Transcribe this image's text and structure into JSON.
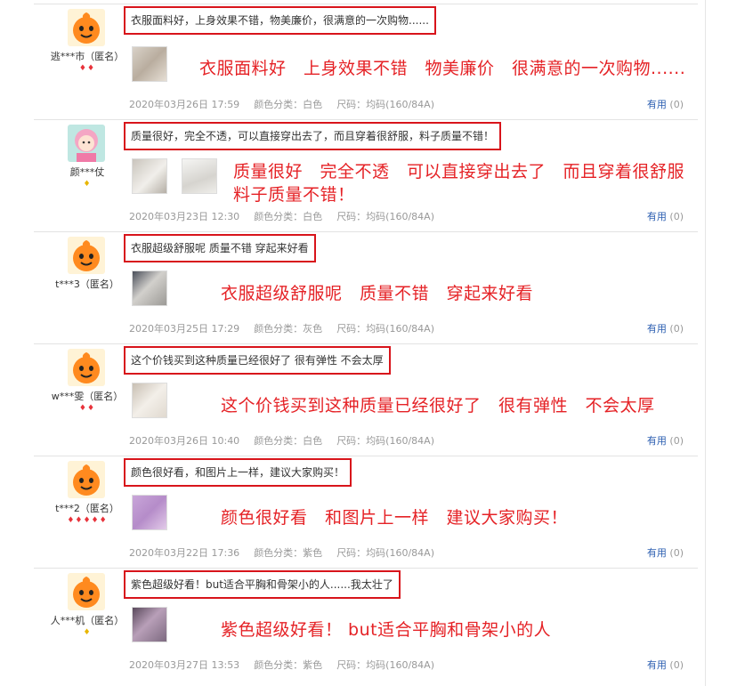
{
  "reviews": [
    {
      "username": "逃***市（匿名）",
      "level": "♦♦",
      "level_color": "#e8323a",
      "avatar_icon": "orange-mascot-avatar",
      "comment": "衣服面料好，上身效果不错，物美廉价，很满意的一次购物......",
      "overlay_lines": [
        "衣服面料好　上身效果不错　物美廉价　很满意的一次购物......"
      ],
      "date": "2020年03月26日 17:59",
      "color": "颜色分类：白色",
      "size": "尺码：均码(160/84A)",
      "helpful_label": "有用",
      "helpful_count": "(0)"
    },
    {
      "username": "颜***仗",
      "level": "♦",
      "level_color": "#e8b600",
      "avatar_icon": "cartoon-girl-avatar",
      "comment": "质量很好，完全不透，可以直接穿出去了，而且穿着很舒服，料子质量不错！",
      "overlay_lines": [
        "质量很好　完全不透　可以直接穿出去了　而且穿着很舒服",
        "料子质量不错！"
      ],
      "date": "2020年03月23日 12:30",
      "color": "颜色分类：白色",
      "size": "尺码：均码(160/84A)",
      "helpful_label": "有用",
      "helpful_count": "(0)"
    },
    {
      "username": "t***3（匿名）",
      "level": "",
      "level_color": "#e8323a",
      "avatar_icon": "orange-mascot-avatar",
      "comment": "衣服超级舒服呢 质量不错 穿起来好看",
      "overlay_lines": [
        "衣服超级舒服呢　质量不错　穿起来好看"
      ],
      "date": "2020年03月25日 17:29",
      "color": "颜色分类：灰色",
      "size": "尺码：均码(160/84A)",
      "helpful_label": "有用",
      "helpful_count": "(0)"
    },
    {
      "username": "w***雯（匿名）",
      "level": "♦♦",
      "level_color": "#e8323a",
      "avatar_icon": "orange-mascot-avatar",
      "comment": "这个价钱买到这种质量已经很好了 很有弹性 不会太厚",
      "overlay_lines": [
        "这个价钱买到这种质量已经很好了　很有弹性　不会太厚"
      ],
      "date": "2020年03月26日 10:40",
      "color": "颜色分类：白色",
      "size": "尺码：均码(160/84A)",
      "helpful_label": "有用",
      "helpful_count": "(0)"
    },
    {
      "username": "t***2（匿名）",
      "level": "♦♦♦♦♦",
      "level_color": "#e8323a",
      "avatar_icon": "orange-mascot-avatar",
      "comment": "颜色很好看，和图片上一样，建议大家购买！",
      "overlay_lines": [
        "颜色很好看　和图片上一样　建议大家购买！"
      ],
      "date": "2020年03月22日 17:36",
      "color": "颜色分类：紫色",
      "size": "尺码：均码(160/84A)",
      "helpful_label": "有用",
      "helpful_count": "(0)"
    },
    {
      "username": "人***机（匿名）",
      "level": "♦",
      "level_color": "#e8b600",
      "avatar_icon": "orange-mascot-avatar",
      "comment": "紫色超级好看！but适合平胸和骨架小的人......我太壮了",
      "overlay_lines": [
        "紫色超级好看！ but适合平胸和骨架小的人"
      ],
      "date": "2020年03月27日 13:53",
      "color": "颜色分类：紫色",
      "size": "尺码：均码(160/84A)",
      "helpful_label": "有用",
      "helpful_count": "(0)"
    }
  ]
}
